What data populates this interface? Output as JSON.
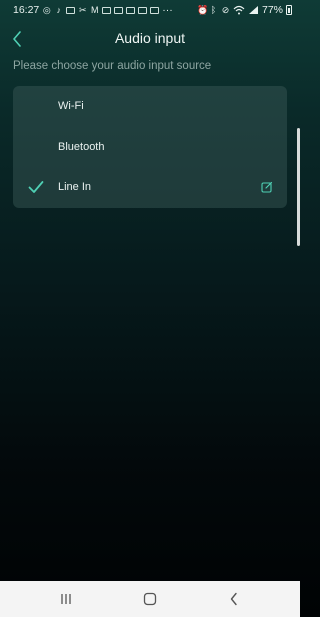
{
  "status_bar": {
    "time": "16:27",
    "battery": "77%",
    "overflow": "···"
  },
  "header": {
    "title": "Audio input"
  },
  "subtitle": "Please choose your audio input source",
  "options": [
    {
      "label": "Wi-Fi",
      "selected": false
    },
    {
      "label": "Bluetooth",
      "selected": false
    },
    {
      "label": "Line In",
      "selected": true,
      "editable": true
    }
  ],
  "colors": {
    "accent": "#4fd0b4",
    "card_bg": "#2f4f4b",
    "navbar_bg": "#f4f4f4"
  }
}
